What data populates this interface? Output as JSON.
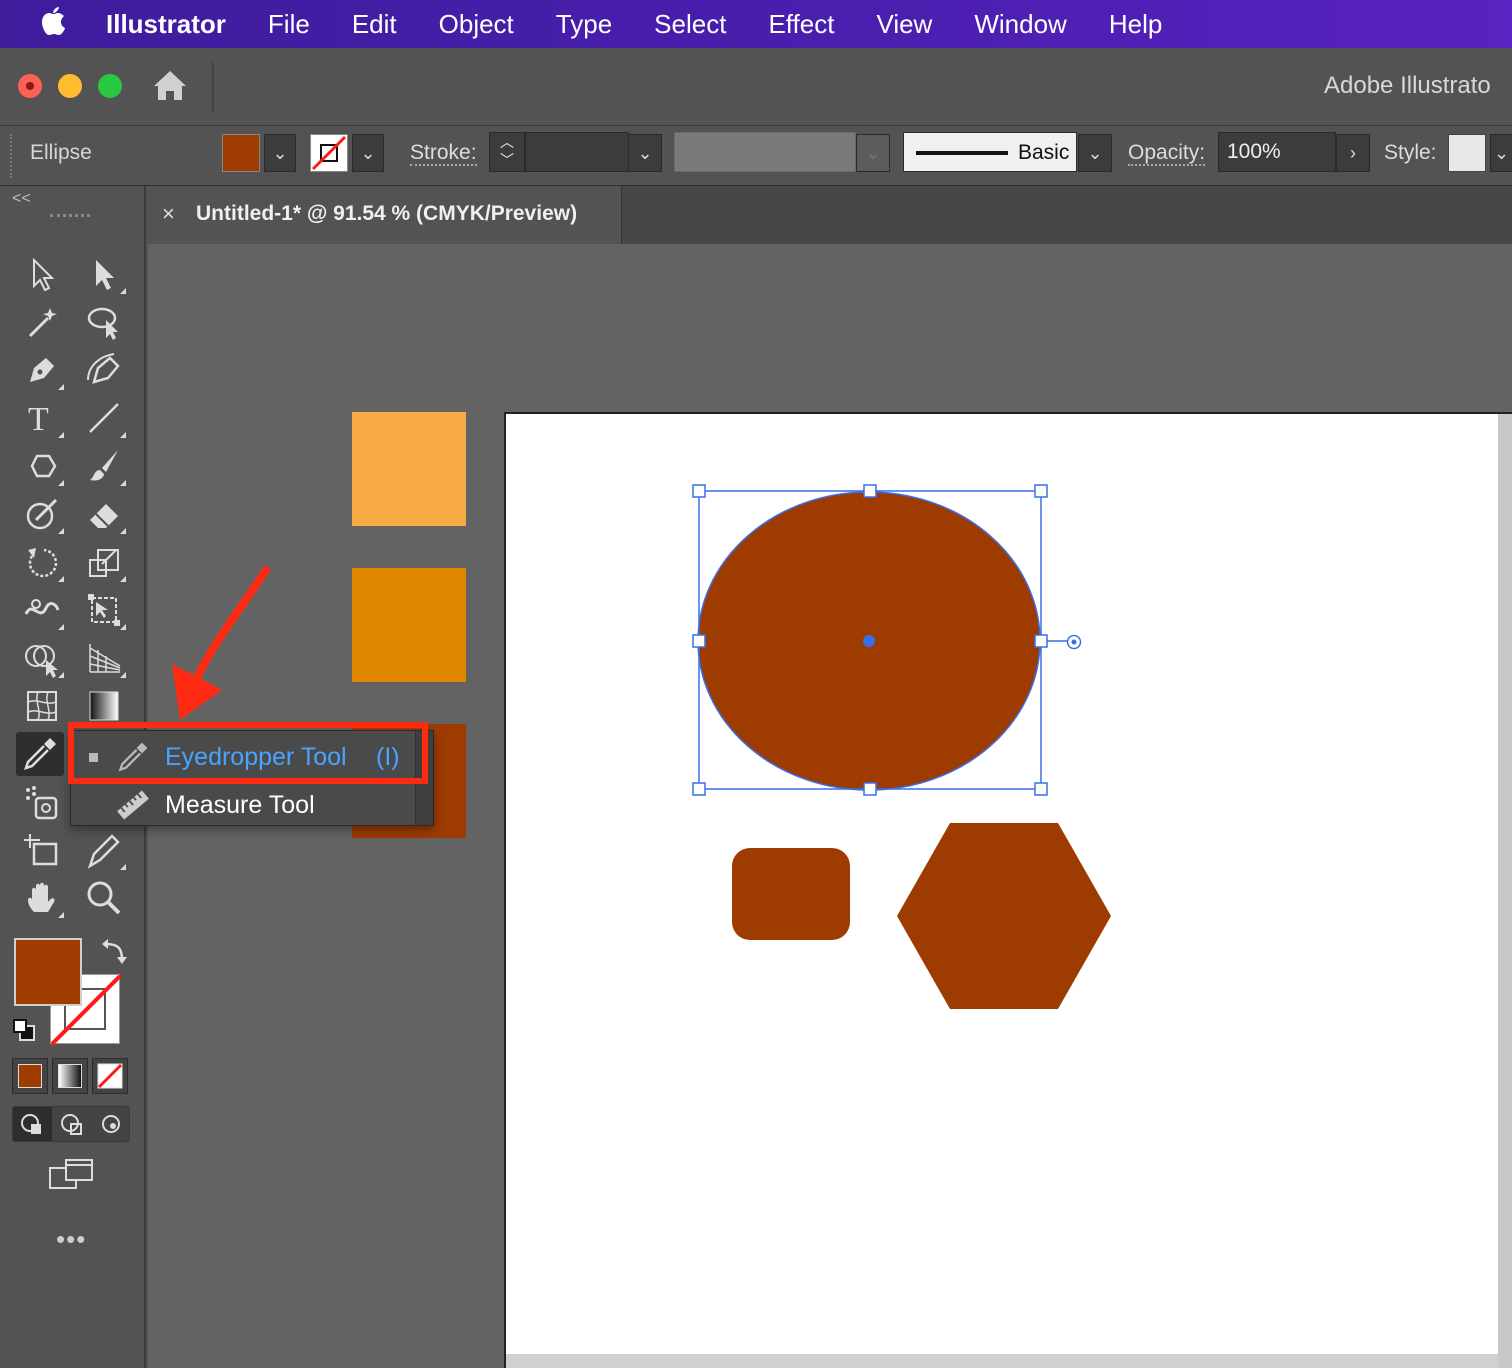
{
  "menubar": {
    "app": "Illustrator",
    "items": [
      "File",
      "Edit",
      "Object",
      "Type",
      "Select",
      "Effect",
      "View",
      "Window",
      "Help"
    ]
  },
  "window": {
    "title": "Adobe Illustrato"
  },
  "control_bar": {
    "object_type": "Ellipse",
    "stroke_label": "Stroke:",
    "brush_label": "Basic",
    "opacity_label": "Opacity:",
    "opacity_value": "100%",
    "style_label": "Style:"
  },
  "document": {
    "tab_title": "Untitled-1* @ 91.54 % (CMYK/Preview)",
    "close": "×"
  },
  "flyout": {
    "items": [
      {
        "label": "Eyedropper Tool",
        "shortcut": "(I)",
        "selected": true
      },
      {
        "label": "Measure Tool",
        "shortcut": "",
        "selected": false
      }
    ]
  },
  "tools_panel": {
    "collapse": "<<",
    "more": "•••"
  },
  "colors": {
    "fill": "#9e3b00",
    "swatch_light_orange": "#f8aa45",
    "swatch_orange": "#e08800",
    "swatch_rust": "#9e3b00",
    "selection_blue": "#3a6ee8",
    "highlight_red": "#ff2a12"
  }
}
